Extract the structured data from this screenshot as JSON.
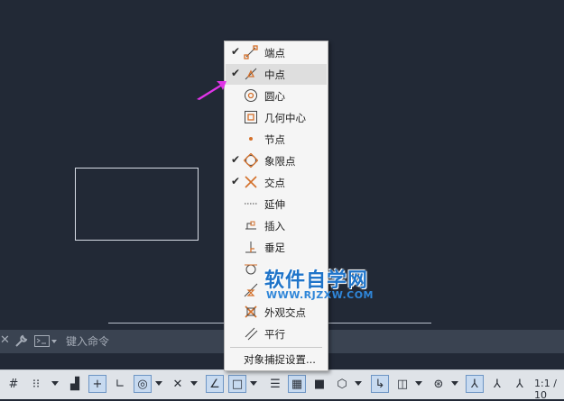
{
  "command_line": {
    "placeholder": "键入命令"
  },
  "snap_menu": {
    "items": [
      {
        "label": "端点",
        "checked": true,
        "icon": "endpoint-icon"
      },
      {
        "label": "中点",
        "checked": true,
        "icon": "midpoint-icon",
        "highlighted": true
      },
      {
        "label": "圆心",
        "checked": false,
        "icon": "center-icon"
      },
      {
        "label": "几何中心",
        "checked": false,
        "icon": "geometric-center-icon"
      },
      {
        "label": "节点",
        "checked": false,
        "icon": "node-icon"
      },
      {
        "label": "象限点",
        "checked": true,
        "icon": "quadrant-icon"
      },
      {
        "label": "交点",
        "checked": true,
        "icon": "intersection-icon"
      },
      {
        "label": "延伸",
        "checked": false,
        "icon": "extension-icon"
      },
      {
        "label": "插入",
        "checked": false,
        "icon": "insertion-icon"
      },
      {
        "label": "垂足",
        "checked": false,
        "icon": "perpendicular-icon"
      },
      {
        "label": "",
        "checked": false,
        "icon": "tangent-icon"
      },
      {
        "label": "",
        "checked": false,
        "icon": "nearest-icon"
      },
      {
        "label": "外观交点",
        "checked": false,
        "icon": "apparent-intersection-icon"
      },
      {
        "label": "平行",
        "checked": false,
        "icon": "parallel-icon"
      }
    ],
    "check_glyph": "✔",
    "settings_label": "对象捕捉设置..."
  },
  "watermark": {
    "title": "软件自学网",
    "url": "WWW.RJZXW.COM"
  },
  "status_bar": {
    "scale_label": "1:1 / 10"
  },
  "colors": {
    "canvas": "#222936",
    "accent": "#3a7ad1",
    "arrow": "#e034e8"
  }
}
